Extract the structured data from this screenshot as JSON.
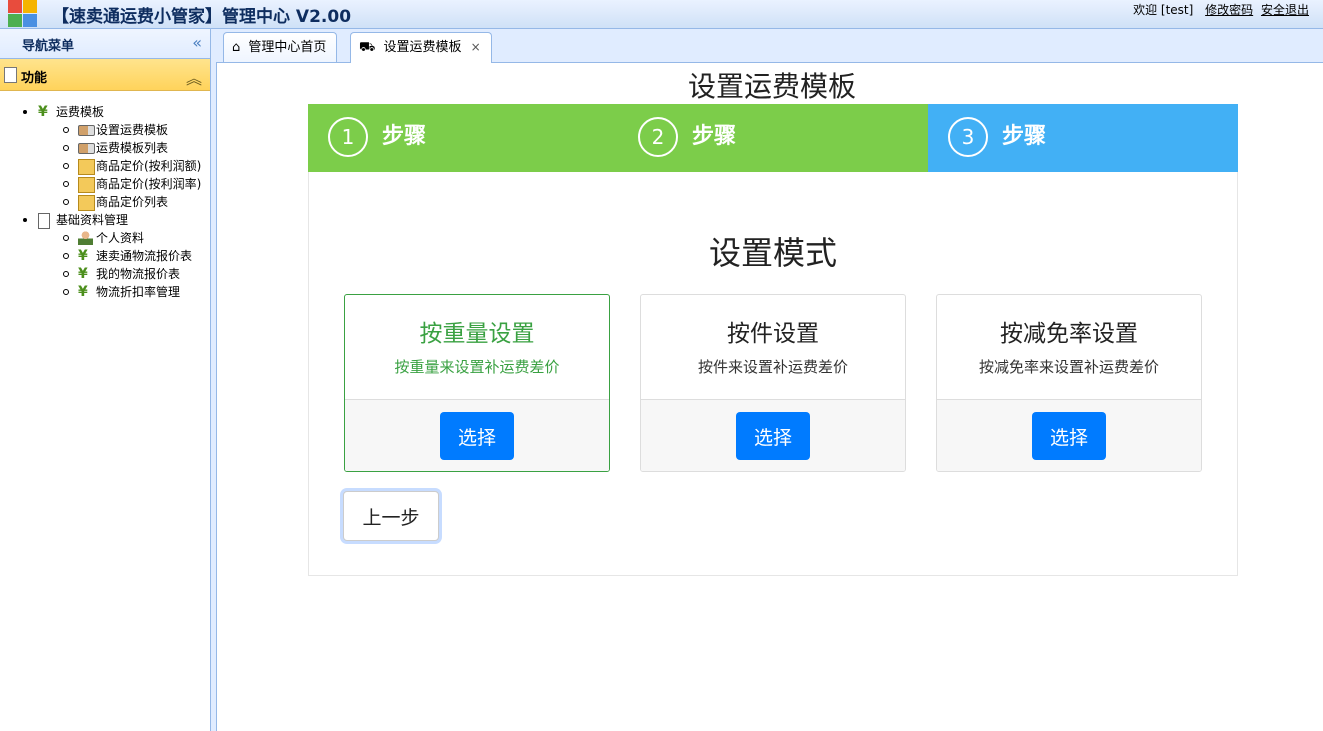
{
  "header": {
    "title": "【速卖通运费小管家】管理中心 V2.00",
    "welcome": "欢迎 [test]",
    "change_password": "修改密码",
    "logout": "安全退出"
  },
  "sidebar": {
    "nav_title": "导航菜单",
    "section_title": "功能",
    "groups": [
      {
        "label": "运费模板",
        "icon": "yen-icon",
        "items": [
          {
            "label": "设置运费模板",
            "icon": "truck-icon"
          },
          {
            "label": "运费模板列表",
            "icon": "truck-icon"
          },
          {
            "label": "商品定价(按利润额)",
            "icon": "folder-icon"
          },
          {
            "label": "商品定价(按利润率)",
            "icon": "folder-icon"
          },
          {
            "label": "商品定价列表",
            "icon": "folder-icon"
          }
        ]
      },
      {
        "label": "基础资料管理",
        "icon": "document-icon",
        "items": [
          {
            "label": "个人资料",
            "icon": "user-icon"
          },
          {
            "label": "速卖通物流报价表",
            "icon": "yen-icon"
          },
          {
            "label": "我的物流报价表",
            "icon": "yen-icon"
          },
          {
            "label": "物流折扣率管理",
            "icon": "yen-icon"
          }
        ]
      }
    ]
  },
  "tabs": [
    {
      "label": "管理中心首页",
      "icon": "home-icon",
      "active": false
    },
    {
      "label": "设置运费模板",
      "icon": "truck-icon",
      "active": true,
      "close": "×"
    }
  ],
  "main": {
    "title": "设置运费模板",
    "steps": [
      {
        "num": "1",
        "label": "步骤",
        "color": "#7ccd4a"
      },
      {
        "num": "2",
        "label": "步骤",
        "color": "#7ccd4a"
      },
      {
        "num": "3",
        "label": "步骤",
        "color": "#42b0f5"
      }
    ],
    "mode_title": "设置模式",
    "cards": [
      {
        "title": "按重量设置",
        "desc": "按重量来设置补运费差价",
        "button": "选择",
        "selected": true
      },
      {
        "title": "按件设置",
        "desc": "按件来设置补运费差价",
        "button": "选择",
        "selected": false
      },
      {
        "title": "按减免率设置",
        "desc": "按减免率来设置补运费差价",
        "button": "选择",
        "selected": false
      }
    ],
    "prev_button": "上一步"
  },
  "colors": {
    "accent_blue": "#007bff",
    "step_done": "#7ccd4a",
    "step_current": "#42b0f5",
    "selected_green": "#3aa142"
  }
}
